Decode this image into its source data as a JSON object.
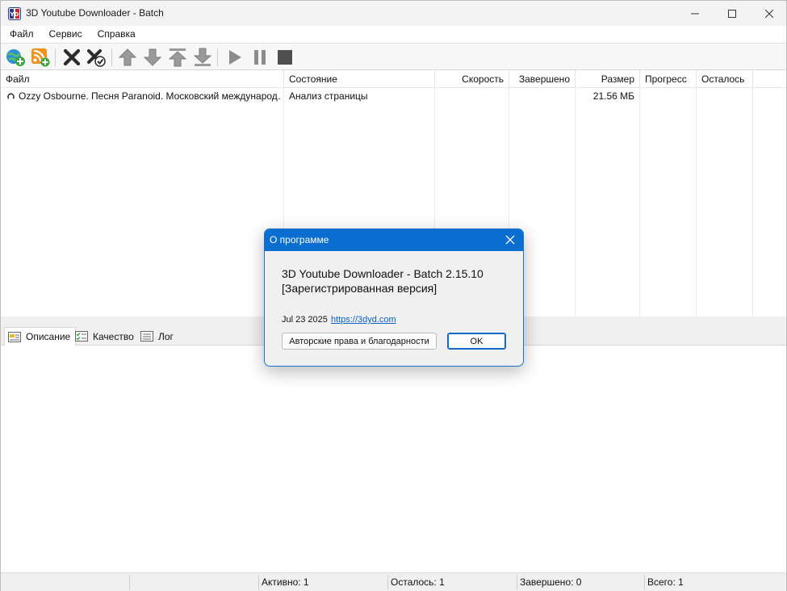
{
  "window": {
    "title": "3D Youtube Downloader - Batch"
  },
  "menu": {
    "items": [
      "Файл",
      "Сервис",
      "Справка"
    ]
  },
  "toolbar": {
    "icons": [
      "add-url-icon",
      "rss-icon",
      "delete-icon",
      "delete-completed-icon",
      "move-up-icon",
      "move-down-icon",
      "move-top-icon",
      "move-bottom-icon",
      "start-icon",
      "pause-icon",
      "stop-icon"
    ]
  },
  "list": {
    "columns": [
      "Файл",
      "Состояние",
      "Скорость",
      "Завершено",
      "Размер",
      "Прогресс",
      "Осталось"
    ],
    "rows": [
      {
        "file": "Ozzy Osbourne. Песня Paranoid. Московский международ…",
        "status": "Анализ страницы",
        "speed": "",
        "done": "",
        "size": "21.56 МБ",
        "progress": "",
        "left": ""
      }
    ]
  },
  "tabs": {
    "items": [
      "Описание",
      "Качество",
      "Лог"
    ],
    "active": "Описание"
  },
  "statusbar": {
    "active": "Активно: 1",
    "remaining": "Осталось: 1",
    "completed": "Завершено: 0",
    "total": "Всего: 1"
  },
  "dialog": {
    "title": "О программе",
    "app_name": "3D Youtube Downloader - Batch 2.15.10",
    "registration": "[Зарегистрированная версия]",
    "date": "Jul 23 2025",
    "link": "https://3dyd.com",
    "credits_button": "Авторские права и благодарности",
    "ok_button": "OK",
    "accent_color": "#0a6ed1"
  }
}
